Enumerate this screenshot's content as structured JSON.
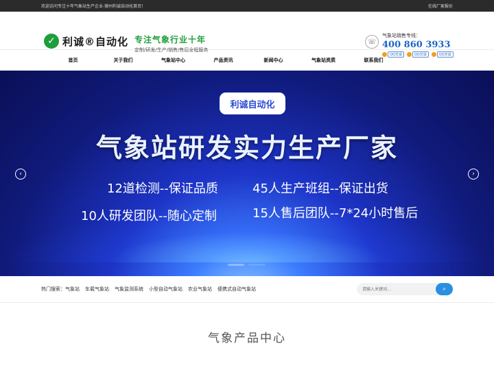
{
  "topbar": {
    "welcome": "欢迎访问专注十年气象站生产企业-德州利诚自动化首页！",
    "quote_link": "在线厂家报价"
  },
  "logo": {
    "mark": "✓",
    "text": "利诚®自动化"
  },
  "slogan": {
    "main": "专注气象行业十年",
    "sub": "定制/研发/生产/销售/售后全程服务"
  },
  "contact": {
    "label": "气象站销售专线：",
    "phone": "400 860 3933",
    "qq_buttons": [
      "QQ交谈",
      "QQ交谈",
      "QQ交谈"
    ]
  },
  "nav": {
    "items": [
      "首页",
      "关于我们",
      "气象站中心",
      "产品资讯",
      "新闻中心",
      "气象站资质",
      "联系我们"
    ]
  },
  "banner": {
    "badge": "利诚自动化",
    "headline": "气象站研发实力生产厂家",
    "features": [
      "12道检测--保证品质",
      "45人生产班组--保证出货",
      "10人研发团队--随心定制",
      "15人售后团队--7*24小时售后"
    ],
    "slides": 2,
    "active_slide": 2
  },
  "search": {
    "hot_label": "热门搜索：",
    "hot_links": [
      "气象站",
      "车载气象站",
      "气象监测系统",
      "小型自动气象站",
      "农业气象站",
      "便携式自动气象站"
    ],
    "placeholder": "请输入关键词..."
  },
  "section": {
    "title": "气象产品中心"
  }
}
